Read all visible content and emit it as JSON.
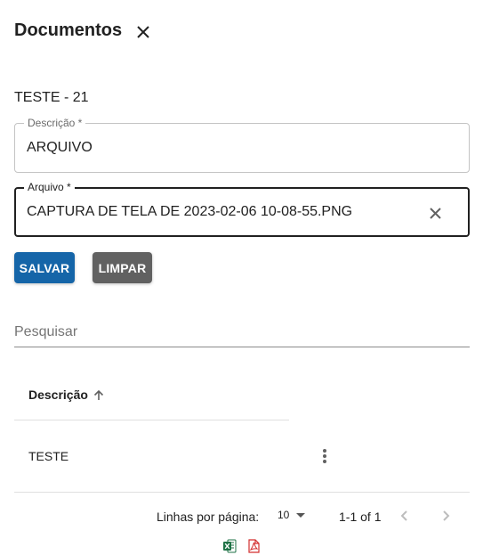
{
  "dialog": {
    "title": "Documentos",
    "close_icon": "close-icon",
    "record_label": "TESTE - 21"
  },
  "form": {
    "descricao": {
      "label": "Descrição *",
      "value": "ARQUIVO"
    },
    "arquivo": {
      "label": "Arquivo *",
      "value": "CAPTURA DE TELA DE 2023-02-06 10-08-55.PNG",
      "clear_icon": "close-icon"
    },
    "save_label": "SALVAR",
    "clear_label": "LIMPAR"
  },
  "colors": {
    "primary": "#1565a8",
    "secondary": "#616161",
    "excel": "#1e7145",
    "pdf": "#d32f2f"
  },
  "search": {
    "placeholder": "Pesquisar",
    "value": ""
  },
  "table": {
    "columns": [
      {
        "label": "Descrição",
        "sort": "ascending",
        "sort_icon": "arrow-up-icon"
      }
    ],
    "rows": [
      {
        "descricao": "TESTE",
        "actions_icon": "more-vertical-icon"
      }
    ]
  },
  "pagination": {
    "rows_per_page_label": "Linhas por página:",
    "rows_per_page_value": "10",
    "range_label": "1-1 of 1"
  },
  "exports": [
    {
      "icon": "excel-icon"
    },
    {
      "icon": "pdf-icon"
    }
  ]
}
